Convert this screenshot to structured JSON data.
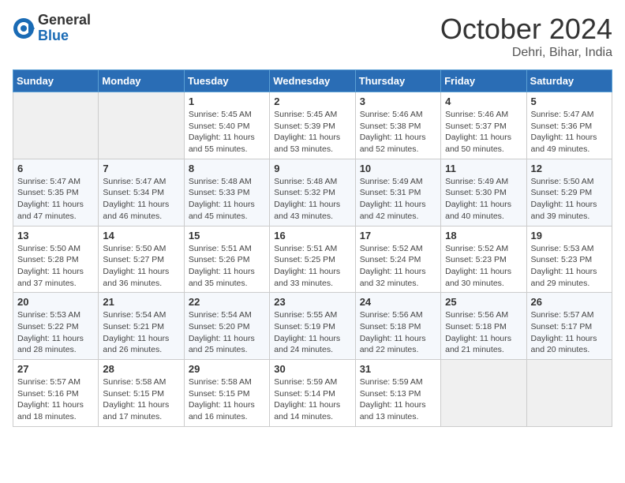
{
  "header": {
    "logo_general": "General",
    "logo_blue": "Blue",
    "month": "October 2024",
    "location": "Dehri, Bihar, India"
  },
  "days_of_week": [
    "Sunday",
    "Monday",
    "Tuesday",
    "Wednesday",
    "Thursday",
    "Friday",
    "Saturday"
  ],
  "weeks": [
    [
      {
        "day": "",
        "sunrise": "",
        "sunset": "",
        "daylight": "",
        "empty": true
      },
      {
        "day": "",
        "sunrise": "",
        "sunset": "",
        "daylight": "",
        "empty": true
      },
      {
        "day": "1",
        "sunrise": "Sunrise: 5:45 AM",
        "sunset": "Sunset: 5:40 PM",
        "daylight": "Daylight: 11 hours and 55 minutes."
      },
      {
        "day": "2",
        "sunrise": "Sunrise: 5:45 AM",
        "sunset": "Sunset: 5:39 PM",
        "daylight": "Daylight: 11 hours and 53 minutes."
      },
      {
        "day": "3",
        "sunrise": "Sunrise: 5:46 AM",
        "sunset": "Sunset: 5:38 PM",
        "daylight": "Daylight: 11 hours and 52 minutes."
      },
      {
        "day": "4",
        "sunrise": "Sunrise: 5:46 AM",
        "sunset": "Sunset: 5:37 PM",
        "daylight": "Daylight: 11 hours and 50 minutes."
      },
      {
        "day": "5",
        "sunrise": "Sunrise: 5:47 AM",
        "sunset": "Sunset: 5:36 PM",
        "daylight": "Daylight: 11 hours and 49 minutes."
      }
    ],
    [
      {
        "day": "6",
        "sunrise": "Sunrise: 5:47 AM",
        "sunset": "Sunset: 5:35 PM",
        "daylight": "Daylight: 11 hours and 47 minutes."
      },
      {
        "day": "7",
        "sunrise": "Sunrise: 5:47 AM",
        "sunset": "Sunset: 5:34 PM",
        "daylight": "Daylight: 11 hours and 46 minutes."
      },
      {
        "day": "8",
        "sunrise": "Sunrise: 5:48 AM",
        "sunset": "Sunset: 5:33 PM",
        "daylight": "Daylight: 11 hours and 45 minutes."
      },
      {
        "day": "9",
        "sunrise": "Sunrise: 5:48 AM",
        "sunset": "Sunset: 5:32 PM",
        "daylight": "Daylight: 11 hours and 43 minutes."
      },
      {
        "day": "10",
        "sunrise": "Sunrise: 5:49 AM",
        "sunset": "Sunset: 5:31 PM",
        "daylight": "Daylight: 11 hours and 42 minutes."
      },
      {
        "day": "11",
        "sunrise": "Sunrise: 5:49 AM",
        "sunset": "Sunset: 5:30 PM",
        "daylight": "Daylight: 11 hours and 40 minutes."
      },
      {
        "day": "12",
        "sunrise": "Sunrise: 5:50 AM",
        "sunset": "Sunset: 5:29 PM",
        "daylight": "Daylight: 11 hours and 39 minutes."
      }
    ],
    [
      {
        "day": "13",
        "sunrise": "Sunrise: 5:50 AM",
        "sunset": "Sunset: 5:28 PM",
        "daylight": "Daylight: 11 hours and 37 minutes."
      },
      {
        "day": "14",
        "sunrise": "Sunrise: 5:50 AM",
        "sunset": "Sunset: 5:27 PM",
        "daylight": "Daylight: 11 hours and 36 minutes."
      },
      {
        "day": "15",
        "sunrise": "Sunrise: 5:51 AM",
        "sunset": "Sunset: 5:26 PM",
        "daylight": "Daylight: 11 hours and 35 minutes."
      },
      {
        "day": "16",
        "sunrise": "Sunrise: 5:51 AM",
        "sunset": "Sunset: 5:25 PM",
        "daylight": "Daylight: 11 hours and 33 minutes."
      },
      {
        "day": "17",
        "sunrise": "Sunrise: 5:52 AM",
        "sunset": "Sunset: 5:24 PM",
        "daylight": "Daylight: 11 hours and 32 minutes."
      },
      {
        "day": "18",
        "sunrise": "Sunrise: 5:52 AM",
        "sunset": "Sunset: 5:23 PM",
        "daylight": "Daylight: 11 hours and 30 minutes."
      },
      {
        "day": "19",
        "sunrise": "Sunrise: 5:53 AM",
        "sunset": "Sunset: 5:23 PM",
        "daylight": "Daylight: 11 hours and 29 minutes."
      }
    ],
    [
      {
        "day": "20",
        "sunrise": "Sunrise: 5:53 AM",
        "sunset": "Sunset: 5:22 PM",
        "daylight": "Daylight: 11 hours and 28 minutes."
      },
      {
        "day": "21",
        "sunrise": "Sunrise: 5:54 AM",
        "sunset": "Sunset: 5:21 PM",
        "daylight": "Daylight: 11 hours and 26 minutes."
      },
      {
        "day": "22",
        "sunrise": "Sunrise: 5:54 AM",
        "sunset": "Sunset: 5:20 PM",
        "daylight": "Daylight: 11 hours and 25 minutes."
      },
      {
        "day": "23",
        "sunrise": "Sunrise: 5:55 AM",
        "sunset": "Sunset: 5:19 PM",
        "daylight": "Daylight: 11 hours and 24 minutes."
      },
      {
        "day": "24",
        "sunrise": "Sunrise: 5:56 AM",
        "sunset": "Sunset: 5:18 PM",
        "daylight": "Daylight: 11 hours and 22 minutes."
      },
      {
        "day": "25",
        "sunrise": "Sunrise: 5:56 AM",
        "sunset": "Sunset: 5:18 PM",
        "daylight": "Daylight: 11 hours and 21 minutes."
      },
      {
        "day": "26",
        "sunrise": "Sunrise: 5:57 AM",
        "sunset": "Sunset: 5:17 PM",
        "daylight": "Daylight: 11 hours and 20 minutes."
      }
    ],
    [
      {
        "day": "27",
        "sunrise": "Sunrise: 5:57 AM",
        "sunset": "Sunset: 5:16 PM",
        "daylight": "Daylight: 11 hours and 18 minutes."
      },
      {
        "day": "28",
        "sunrise": "Sunrise: 5:58 AM",
        "sunset": "Sunset: 5:15 PM",
        "daylight": "Daylight: 11 hours and 17 minutes."
      },
      {
        "day": "29",
        "sunrise": "Sunrise: 5:58 AM",
        "sunset": "Sunset: 5:15 PM",
        "daylight": "Daylight: 11 hours and 16 minutes."
      },
      {
        "day": "30",
        "sunrise": "Sunrise: 5:59 AM",
        "sunset": "Sunset: 5:14 PM",
        "daylight": "Daylight: 11 hours and 14 minutes."
      },
      {
        "day": "31",
        "sunrise": "Sunrise: 5:59 AM",
        "sunset": "Sunset: 5:13 PM",
        "daylight": "Daylight: 11 hours and 13 minutes."
      },
      {
        "day": "",
        "sunrise": "",
        "sunset": "",
        "daylight": "",
        "empty": true
      },
      {
        "day": "",
        "sunrise": "",
        "sunset": "",
        "daylight": "",
        "empty": true
      }
    ]
  ]
}
